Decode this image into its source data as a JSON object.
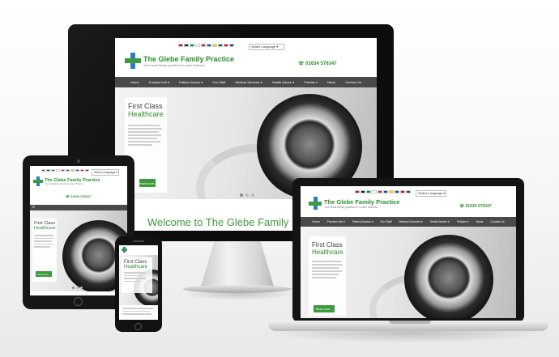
{
  "site": {
    "brand": "The Glebe Family Practice",
    "tagline": "Your local family practice in Lower Halstow",
    "phone": "01634 576347",
    "language_select": "Select Language",
    "nav": [
      "Home",
      "Practice Info ▾",
      "Patient Access ▾",
      "Our Staff",
      "Medical Services ▾",
      "Health Advice ▾",
      "Policies ▾",
      "News",
      "Contact Us"
    ],
    "hero_title_1": "First Class",
    "hero_title_2": "Healthcare",
    "hero_body": "We are a new doctor GP practice in Gillingham providing high NHS medical services in range of additional services and clinical medical advice.",
    "hero_button": "Read more...",
    "welcome": "Welcome to The Glebe Family Practice"
  },
  "colors": {
    "brand_green": "#2d8f2d",
    "nav_grey": "#4a4a4a",
    "device_black": "#111111",
    "cross_blue": "#2a7fc0"
  },
  "flags": [
    "#c8102e",
    "#012169",
    "#009246",
    "#ffffff",
    "#d52b1e",
    "#0055a4",
    "#ffce00",
    "#006847",
    "#e30a17",
    "#1a3d8f"
  ]
}
